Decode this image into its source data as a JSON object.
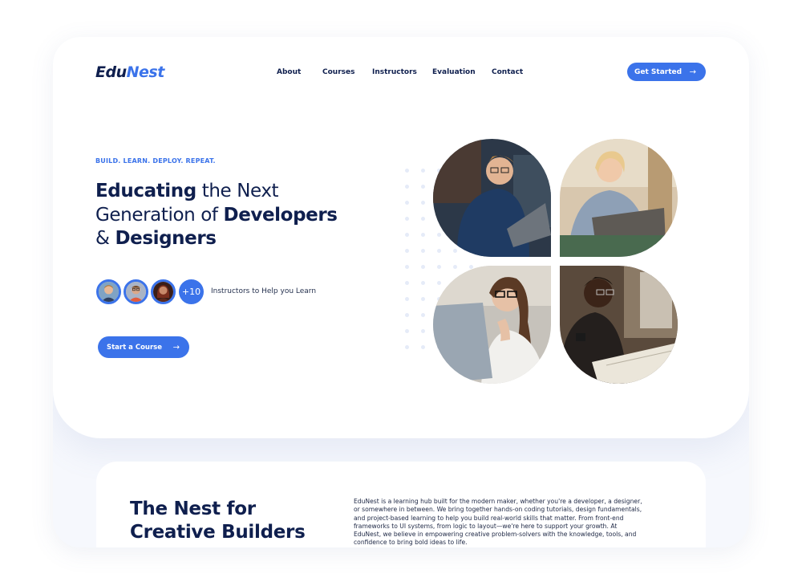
{
  "logo": {
    "part1": "Edu",
    "part2": "Nest"
  },
  "nav": {
    "links": [
      "About",
      "Courses",
      "Instructors",
      "Evaluation",
      "Contact"
    ],
    "cta_label": "Get Started"
  },
  "hero": {
    "tagline": "BUILD. LEARN. DEPLOY. REPEAT.",
    "headline": {
      "w1_bold": "Educating",
      "w2": " the Next",
      "w3": "Generation of ",
      "w4_bold": "Developers",
      "w5": "& ",
      "w6_bold": "Designers"
    },
    "instructors_more": "+10",
    "instructors_text": "Instructors to Help you Learn",
    "start_label": "Start a Course"
  },
  "about": {
    "title_part1": "The ",
    "title_bold": "Nest",
    "title_part2": " for",
    "title_line2": "Creative Builders",
    "text_lines": [
      "EduNest is a learning hub built for the modern maker, whether you're a developer, a designer,",
      "or somewhere in between. We bring together hands-on coding tutorials, design fundamentals,",
      "and project-based learning to help you build real-world skills that matter. From front-end",
      "frameworks to UI systems, from logic to layout—we're here to support your growth. At",
      "EduNest, we believe in empowering creative problem-solvers with the knowledge, tools, and",
      "confidence to bring bold ideas to life."
    ]
  },
  "colors": {
    "brand": "#3b73ea",
    "navy": "#0f1f4e"
  },
  "icons": {
    "arrow": "arrow-right-icon"
  }
}
